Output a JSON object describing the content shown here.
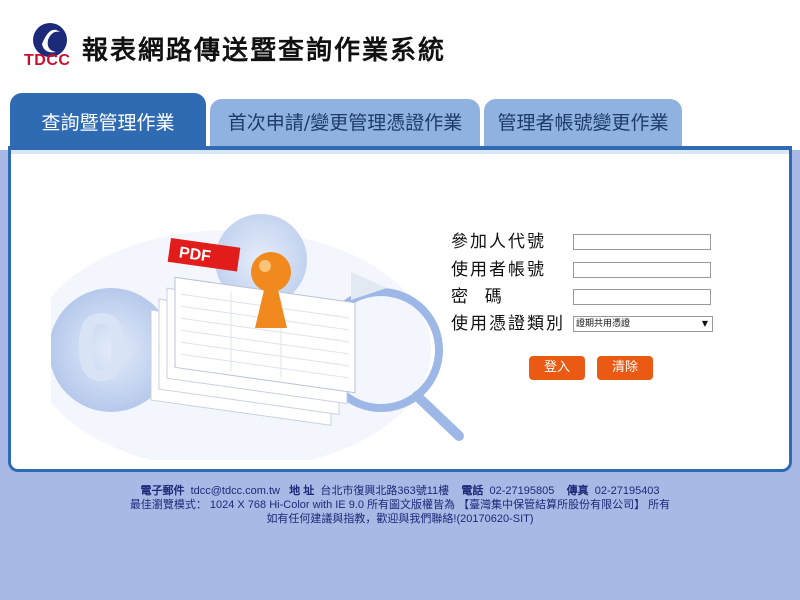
{
  "header": {
    "logo_text": "TDCC",
    "title": "報表網路傳送暨查詢作業系統"
  },
  "tabs": [
    {
      "label": "查詢暨管理作業",
      "active": true
    },
    {
      "label": "首次申請/變更管理憑證作業",
      "active": false
    },
    {
      "label": "管理者帳號變更作業",
      "active": false
    }
  ],
  "illustration": {
    "pdf_label": "PDF"
  },
  "form": {
    "participant_id_label": "參加人代號",
    "user_account_label": "使用者帳號",
    "password_label": "密  碼",
    "cert_type_label": "使用憑證類別",
    "cert_type_selected": "證期共用憑證",
    "login_button": "登入",
    "clear_button": "清除"
  },
  "footer": {
    "email_label": "電子郵件",
    "email": "tdcc@tdcc.com.tw",
    "address_label": "地  址",
    "address": "台北市復興北路363號11樓",
    "phone_label": "電話",
    "phone": "02-27195805",
    "fax_label": "傳真",
    "fax": "02-27195403",
    "line2": "最佳瀏覽模式： 1024 X 768 Hi-Color with IE 9.0 所有圖文版權皆為 【臺灣集中保管結算所股份有限公司】 所有",
    "line3": "如有任何建議與指教，歡迎與我們聯絡!(20170620-SIT)"
  },
  "colors": {
    "brand_blue": "#2f6bb3",
    "tab_inactive": "#8fb2e1",
    "button_orange": "#ea5a14",
    "page_bg": "#a7b9e4"
  }
}
